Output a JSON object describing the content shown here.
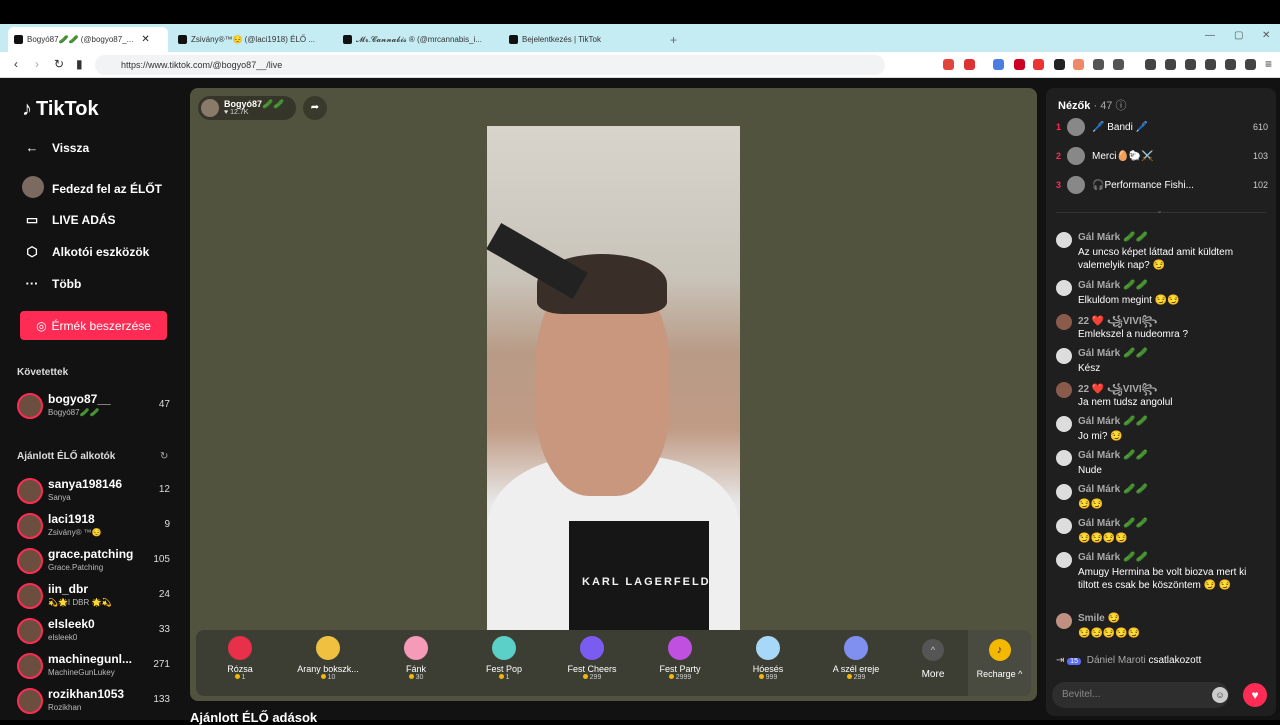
{
  "browser": {
    "tabs": [
      {
        "label": "Bogyó87🥒🥒 (@bogyo87_..."
      },
      {
        "label": "Zsivány®™😔 (@laci1918) ÉLŐ ..."
      },
      {
        "label": "𝓜𝓻.𝓒𝓪𝓷𝓷𝓪𝓫𝓲𝓼 ® (@mrcannabis_i..."
      },
      {
        "label": "Bejelentkezés | TikTok"
      }
    ],
    "new_tab": "+",
    "url": "https://www.tiktok.com/@bogyo87__/live"
  },
  "sidebar": {
    "logo": "TikTok",
    "menu": [
      {
        "icon": "←",
        "label": "Vissza"
      },
      {
        "icon": "",
        "label": "Fedezd fel az ÉLŐT"
      },
      {
        "icon": "▭",
        "label": "LIVE ADÁS"
      },
      {
        "icon": "⬡",
        "label": "Alkotói eszközök"
      },
      {
        "icon": "···",
        "label": "Több"
      }
    ],
    "coins_button": "Érmék beszerzése",
    "following_title": "Követettek",
    "following": [
      {
        "name": "bogyo87__",
        "sub": "Bogyó87🥒🥒",
        "count": "47"
      }
    ],
    "recommended_title": "Ajánlott ÉLŐ alkotók",
    "recommended": [
      {
        "name": "sanya198146",
        "sub": "Sanya",
        "count": "12"
      },
      {
        "name": "laci1918",
        "sub": "Zsivány® ™😔",
        "count": "9"
      },
      {
        "name": "grace.patching",
        "sub": "Grace.Patching",
        "count": "105"
      },
      {
        "name": "iin_dbr",
        "sub": "💫🌟I DBR 🌟💫",
        "count": "24"
      },
      {
        "name": "elsleek0",
        "sub": "elsleek0",
        "count": "33"
      },
      {
        "name": "machinegunl...",
        "sub": "MachineGunLukey",
        "count": "271"
      },
      {
        "name": "rozikhan1053",
        "sub": "Rozikhan",
        "count": "133"
      }
    ]
  },
  "stream": {
    "host_name": "Bogyó87🥒🥒",
    "host_likes": "♥ 12.7K",
    "video_logo": "KARL LAGERFELD",
    "gifts": [
      {
        "name": "Rózsa",
        "price": "1",
        "color": "#e8304a"
      },
      {
        "name": "Arany bokszk...",
        "price": "10",
        "color": "#f0c040"
      },
      {
        "name": "Fánk",
        "price": "30",
        "color": "#f59ab8"
      },
      {
        "name": "Fest Pop",
        "price": "1",
        "color": "#5ad0c8"
      },
      {
        "name": "Fest Cheers",
        "price": "299",
        "color": "#7a5cf0"
      },
      {
        "name": "Fest Party",
        "price": "2999",
        "color": "#c050e0"
      },
      {
        "name": "Hóesés",
        "price": "999",
        "color": "#a8d8f8"
      },
      {
        "name": "A szél ereje",
        "price": "299",
        "color": "#8090f0"
      }
    ],
    "more_label": "More",
    "recharge_label": "Recharge ^",
    "below_title": "Ajánlott ÉLŐ adások"
  },
  "viewers": {
    "title": "Nézők",
    "count": "· 47",
    "list": [
      {
        "rank": "1",
        "name": "🖊️ Bandi 🖊️",
        "score": "610"
      },
      {
        "rank": "2",
        "name": "Merci🥚🐑⚔️",
        "score": "103"
      },
      {
        "rank": "3",
        "name": "🎧Performance Fishi...",
        "score": "102"
      }
    ]
  },
  "chat": {
    "messages": [
      {
        "name": "Gál Márk 🥒🥒",
        "text": "Az uncso képet láttad amit küldtem valemelyik nap? 😏"
      },
      {
        "name": "Gál Márk 🥒🥒",
        "text": "Elkuldom megint 😏😏"
      },
      {
        "name": "22 ❤️ ꧁VIVI꧂",
        "text": "Emlekszel a nudeomra ?"
      },
      {
        "name": "Gál Márk 🥒🥒",
        "text": "Kész"
      },
      {
        "name": "22 ❤️ ꧁VIVI꧂",
        "text": "Ja nem tudsz angolul"
      },
      {
        "name": "Gál Márk 🥒🥒",
        "text": "Jo mi? 😏"
      },
      {
        "name": "Gál Márk 🥒🥒",
        "text": "Nude"
      },
      {
        "name": "Gál Márk 🥒🥒",
        "text": "😏😏"
      },
      {
        "name": "Gál Márk 🥒🥒",
        "text": "😏😏😏😏"
      },
      {
        "name": "Gál Márk 🥒🥒",
        "text": "Amugy Hermina be volt biozva mert ki tiltott es csak be köszöntem 😏 😏"
      },
      {
        "name": "Smile 😏",
        "text": "😏😏😏😏😏"
      }
    ],
    "joined_badge": "15",
    "joined_name": "Dániel Maroti",
    "joined_text": "csatlakozott",
    "input_placeholder": "Bevitel..."
  }
}
